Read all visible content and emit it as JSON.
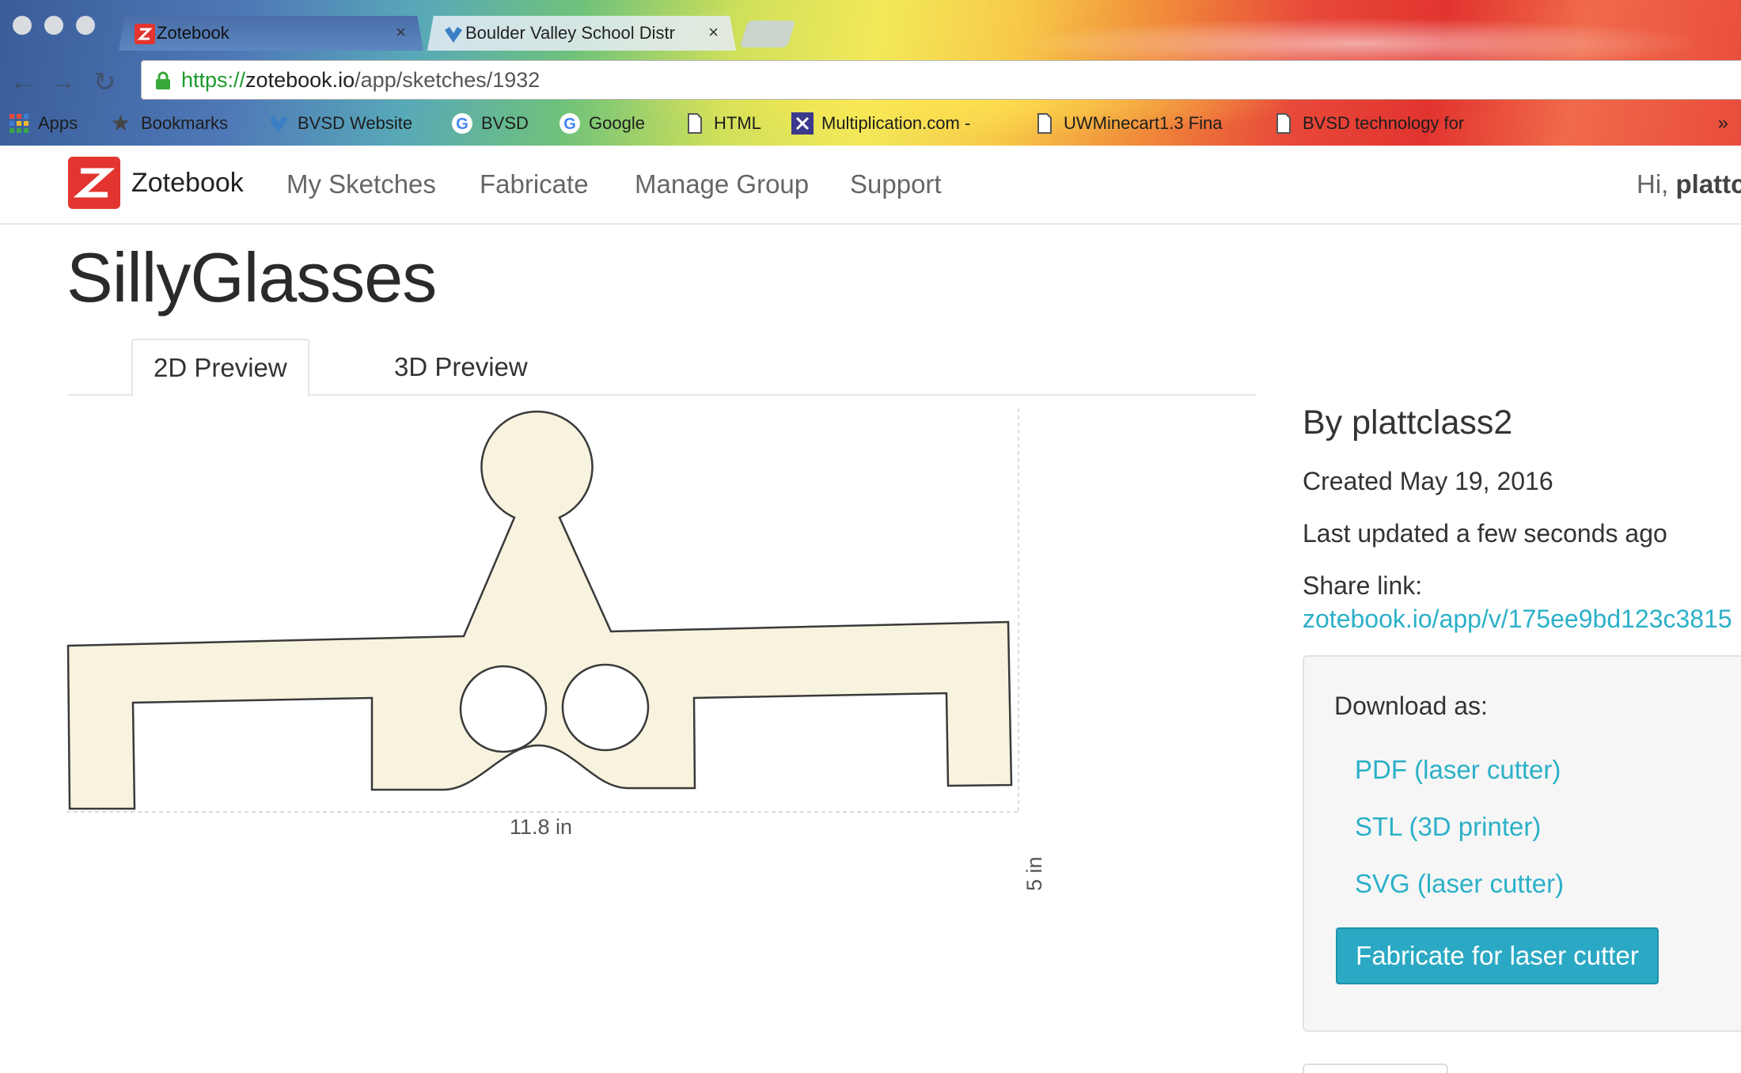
{
  "browser": {
    "tabs": [
      {
        "title": "Zotebook",
        "active": true,
        "icon": "zotebook-favicon"
      },
      {
        "title": "Boulder Valley School Distr",
        "active": false,
        "icon": "bvsd-favicon"
      }
    ],
    "close_glyph": "×",
    "url": {
      "scheme": "https://",
      "host": "zotebook.io",
      "path": "/app/sketches/1932"
    },
    "bookmarks": [
      {
        "label": "Apps",
        "icon": "apps-grid-icon"
      },
      {
        "label": "Bookmarks",
        "icon": "star-icon"
      },
      {
        "label": "BVSD Website",
        "icon": "bvsd-icon"
      },
      {
        "label": "BVSD",
        "icon": "google-icon"
      },
      {
        "label": "Google",
        "icon": "google-icon"
      },
      {
        "label": "HTML",
        "icon": "page-icon"
      },
      {
        "label": "Multiplication.com -",
        "icon": "multiplication-icon"
      },
      {
        "label": "UWMinecart1.3 Fina",
        "icon": "page-icon"
      },
      {
        "label": "BVSD technology for",
        "icon": "page-icon"
      }
    ],
    "more_glyph": "»"
  },
  "header": {
    "brand": "Zotebook",
    "nav": [
      "My Sketches",
      "Fabricate",
      "Manage Group",
      "Support"
    ],
    "greeting_prefix": "Hi, ",
    "greeting_user": "plattcl"
  },
  "sketch": {
    "title": "SillyGlasses",
    "tabs": [
      "2D Preview",
      "3D Preview"
    ],
    "active_tab": "2D Preview",
    "width_label": "11.8 in",
    "height_label": "5 in",
    "fill_color": "#f7f3de",
    "stroke_color": "#3a3a3a"
  },
  "sidebar": {
    "author": "By plattclass2",
    "created": "Created May 19, 2016",
    "updated": "Last updated a few seconds ago",
    "share_label": "Share link:",
    "share_url": "zotebook.io/app/v/175ee9bd123c3815",
    "download_title": "Download as:",
    "downloads": [
      "PDF (laser cutter)",
      "STL (3D printer)",
      "SVG (laser cutter)"
    ],
    "fabricate_button": "Fabricate for laser cutter",
    "accent_color": "#2bb0c8"
  }
}
